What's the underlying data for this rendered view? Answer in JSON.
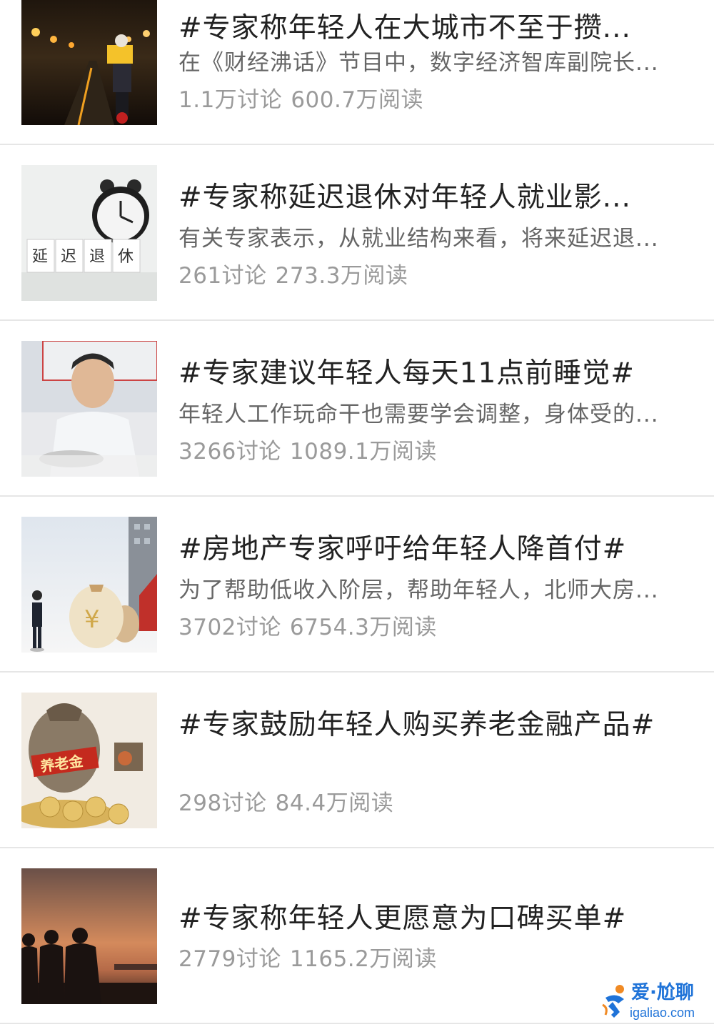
{
  "items": [
    {
      "title": "#专家称年轻人在大城市不至于攒...",
      "summary": "在《财经沸话》节目中，数字经济智库副院长...",
      "discussions": "1.1万讨论",
      "reads": "600.7万阅读",
      "image": "night-delivery-rider"
    },
    {
      "title": "#专家称延迟退休对年轻人就业影...",
      "summary": "有关专家表示，从就业结构来看，将来延迟退...",
      "discussions": "261讨论",
      "reads": "273.3万阅读",
      "image": "alarm-clock-delayed-retirement",
      "image_text": [
        "延",
        "迟",
        "退",
        "休"
      ]
    },
    {
      "title": "#专家建议年轻人每天11点前睡觉#",
      "summary": "年轻人工作玩命干也需要学会调整，身体受的...",
      "discussions": "3266讨论",
      "reads": "1089.1万阅读",
      "image": "elderly-man-eating"
    },
    {
      "title": "#房地产专家呼吁给年轻人降首付#",
      "summary": "为了帮助低收入阶层，帮助年轻人，北师大房...",
      "discussions": "3702讨论",
      "reads": "6754.3万阅读",
      "image": "money-bags-house"
    },
    {
      "title": "#专家鼓励年轻人购买养老金融产品#",
      "summary": "",
      "discussions": "298讨论",
      "reads": "84.4万阅读",
      "image": "pension-coins-bag",
      "image_text": "养老金"
    },
    {
      "title": "#专家称年轻人更愿意为口碑买单#",
      "summary": "",
      "discussions": "2779讨论",
      "reads": "1165.2万阅读",
      "image": "sunset-silhouettes"
    }
  ],
  "watermark": {
    "brand": "爱·尬聊",
    "url": "igaliao.com",
    "color": "#1f73d8"
  },
  "colors": {
    "title": "#222222",
    "summary": "#666666",
    "stats": "#9a9a9a",
    "divider": "#e6e6e6"
  }
}
